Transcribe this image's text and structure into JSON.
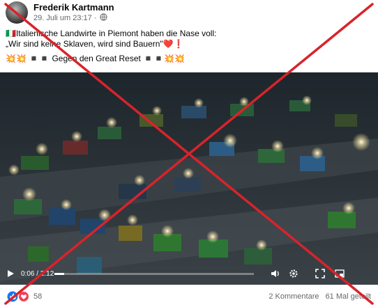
{
  "post": {
    "author": "Frederik Kartmann",
    "timestamp": "29. Juli um 23:17",
    "separator": "·",
    "audience_icon": "globe-icon",
    "text_line1": "Italienische Landwirte in Piemont haben die Nase voll:",
    "text_line2": "„Wir sind keine Sklaven, wird sind Bauern\"",
    "line1_prefix_emoji": "🇮🇹",
    "line2_suffix_emoji": "❤️❗",
    "text_line3_prefix": "💥💥 ◾◾",
    "text_line3": "Gegen den Great Reset",
    "text_line3_suffix": "◾◾💥💥"
  },
  "video": {
    "current_time": "0:06",
    "duration": "/ 2:12",
    "progress": 0.05,
    "icons": [
      "play-icon",
      "volume-icon",
      "settings-icon",
      "fullscreen-icon"
    ]
  },
  "footer": {
    "reaction_icons": [
      "like-icon",
      "love-icon"
    ],
    "reaction_count": "58",
    "comments": "2 Kommentare",
    "shares": "61 Mal geteilt"
  },
  "overlay": {
    "cross_color": "#d9232a"
  }
}
